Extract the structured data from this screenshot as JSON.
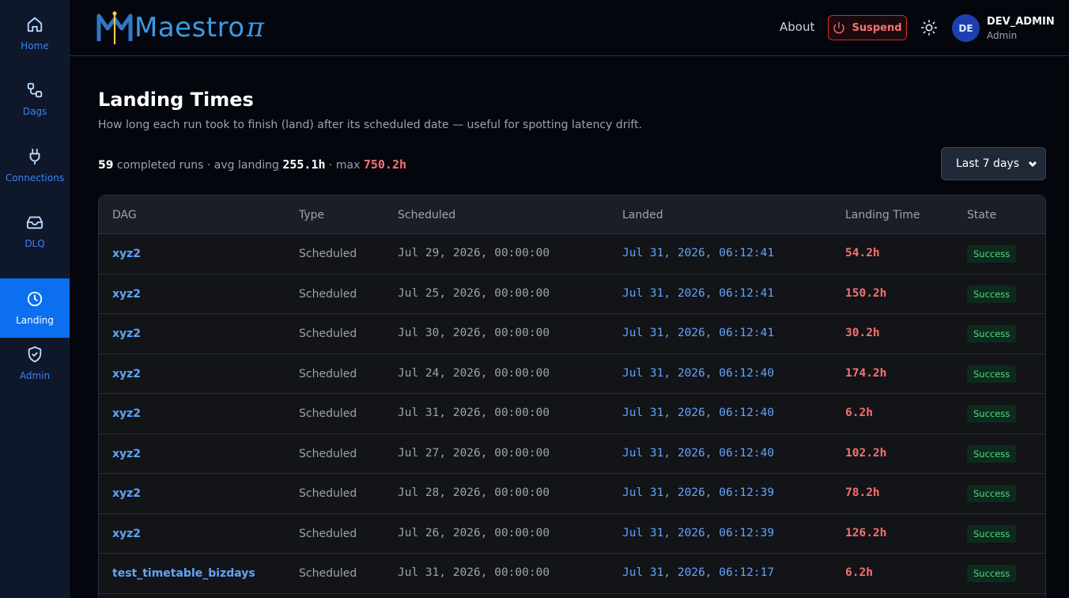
{
  "sidebar": {
    "items": [
      {
        "label": "Home",
        "icon": "home-icon",
        "active": false
      },
      {
        "label": "Dags",
        "icon": "workflow-icon",
        "active": false
      },
      {
        "label": "Connections",
        "icon": "plug-icon",
        "active": false
      },
      {
        "label": "DLQ",
        "icon": "inbox-icon",
        "active": false
      },
      {
        "label": "Landing",
        "icon": "clock-icon",
        "active": true
      },
      {
        "label": "Admin",
        "icon": "shield-check-icon",
        "active": false
      }
    ]
  },
  "header": {
    "logo_text": "Maestro",
    "logo_suffix": "π",
    "about_label": "About",
    "suspend_label": "Suspend",
    "user": {
      "initials": "DE",
      "name": "DEV_ADMIN",
      "role": "Admin"
    }
  },
  "page": {
    "title": "Landing Times",
    "subtitle": "How long each run took to finish (land) after its scheduled date — useful for spotting latency drift."
  },
  "summary": {
    "count": "59",
    "count_text": " completed runs · avg landing ",
    "avg": "255.1h",
    "max_text": " · max ",
    "max": "750.2h"
  },
  "range_select": {
    "selected": "Last 7 days"
  },
  "table": {
    "headers": [
      "DAG",
      "Type",
      "Scheduled",
      "Landed",
      "Landing Time",
      "State"
    ],
    "rows": [
      {
        "dag": "xyz2",
        "type": "Scheduled",
        "scheduled": "Jul 29, 2026, 00:00:00",
        "landed": "Jul 31, 2026, 06:12:41",
        "landing_time": "54.2h",
        "state": "Success"
      },
      {
        "dag": "xyz2",
        "type": "Scheduled",
        "scheduled": "Jul 25, 2026, 00:00:00",
        "landed": "Jul 31, 2026, 06:12:41",
        "landing_time": "150.2h",
        "state": "Success"
      },
      {
        "dag": "xyz2",
        "type": "Scheduled",
        "scheduled": "Jul 30, 2026, 00:00:00",
        "landed": "Jul 31, 2026, 06:12:41",
        "landing_time": "30.2h",
        "state": "Success"
      },
      {
        "dag": "xyz2",
        "type": "Scheduled",
        "scheduled": "Jul 24, 2026, 00:00:00",
        "landed": "Jul 31, 2026, 06:12:40",
        "landing_time": "174.2h",
        "state": "Success"
      },
      {
        "dag": "xyz2",
        "type": "Scheduled",
        "scheduled": "Jul 31, 2026, 00:00:00",
        "landed": "Jul 31, 2026, 06:12:40",
        "landing_time": "6.2h",
        "state": "Success"
      },
      {
        "dag": "xyz2",
        "type": "Scheduled",
        "scheduled": "Jul 27, 2026, 00:00:00",
        "landed": "Jul 31, 2026, 06:12:40",
        "landing_time": "102.2h",
        "state": "Success"
      },
      {
        "dag": "xyz2",
        "type": "Scheduled",
        "scheduled": "Jul 28, 2026, 00:00:00",
        "landed": "Jul 31, 2026, 06:12:39",
        "landing_time": "78.2h",
        "state": "Success"
      },
      {
        "dag": "xyz2",
        "type": "Scheduled",
        "scheduled": "Jul 26, 2026, 00:00:00",
        "landed": "Jul 31, 2026, 06:12:39",
        "landing_time": "126.2h",
        "state": "Success"
      },
      {
        "dag": "test_timetable_bizdays",
        "type": "Scheduled",
        "scheduled": "Jul 31, 2026, 00:00:00",
        "landed": "Jul 31, 2026, 06:12:17",
        "landing_time": "6.2h",
        "state": "Success"
      }
    ]
  }
}
